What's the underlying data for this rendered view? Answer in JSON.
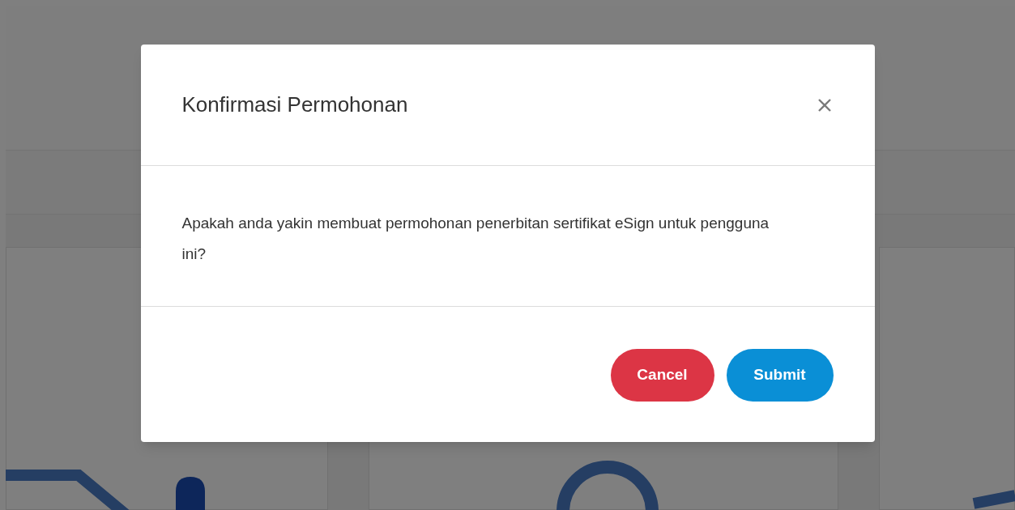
{
  "dialog": {
    "title": "Konfirmasi Permohonan",
    "message": "Apakah anda yakin membuat permohonan penerbitan sertifikat eSign untuk pengguna ini?",
    "buttons": [
      {
        "label": "Cancel",
        "kind": "cancel"
      },
      {
        "label": "Submit",
        "kind": "submit"
      }
    ]
  }
}
